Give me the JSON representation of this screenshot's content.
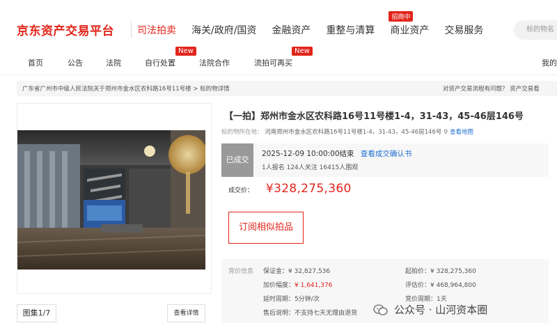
{
  "header": {
    "logo": "京东资产交易平台",
    "nav": [
      {
        "label": "司法拍卖",
        "active": true
      },
      {
        "label": "海关/政府/国资"
      },
      {
        "label": "金融资产"
      },
      {
        "label": "重整与清算"
      },
      {
        "label": "商业资产",
        "badge": "招商中"
      },
      {
        "label": "交易服务"
      }
    ],
    "search_placeholder": "标的物名"
  },
  "subnav": {
    "items": [
      {
        "label": "首页"
      },
      {
        "label": "公告"
      },
      {
        "label": "法院"
      },
      {
        "label": "自行处置",
        "badge": "New"
      },
      {
        "label": "法院合作"
      },
      {
        "label": "流拍可再买",
        "badge": "New"
      }
    ],
    "right_label": "我的"
  },
  "breadcrumb": {
    "path": "广东省广州市中级人民法院关于郑州市金水区农科路16号11号楼 > 标的物详情",
    "help": "对资产交易流程有问题？ 资产交易看"
  },
  "gallery": {
    "counter": "图集1/7",
    "detail_button": "查看详情"
  },
  "item": {
    "title": "【一拍】郑州市金水区农科路16号11号楼1-4，31-43，45-46层146号",
    "location_label": "标的物所在地：",
    "location_value": "河南郑州市金水区农科路16号11号楼1-4，31-43，45-46层146号",
    "map_link": "查看地图"
  },
  "status": {
    "badge": "已成交",
    "end_time": "2025-12-09 10:00:00结束",
    "confirm_link": "查看成交确认书",
    "stats": "1人报名  124人关注  16415人围观"
  },
  "deal": {
    "label": "成交价：",
    "price": "¥328,275,360",
    "subscribe_button": "订阅相似拍品"
  },
  "info": {
    "heading": "竞价信息",
    "rows": [
      {
        "left_k": "保证金：",
        "left_v": "¥ 32,827,536",
        "right_k": "起拍价：",
        "right_v": "¥ 328,275,360"
      },
      {
        "left_k": "加价幅度：",
        "left_v": "¥ 1,641,376",
        "right_k": "评估价：",
        "right_v": "¥ 468,964,800"
      },
      {
        "left_k": "延时周期：",
        "left_v": "5分钟/次",
        "right_k": "竞价周期：",
        "right_v": "1天"
      },
      {
        "left_k": "售后说明：",
        "left_v": "不支持七天无理由退货",
        "right_k": "",
        "right_v": ""
      }
    ]
  },
  "watermark": "公众号 · 山河资本圈",
  "colors": {
    "brand": "#e1251b",
    "link": "#1f6fd1"
  }
}
